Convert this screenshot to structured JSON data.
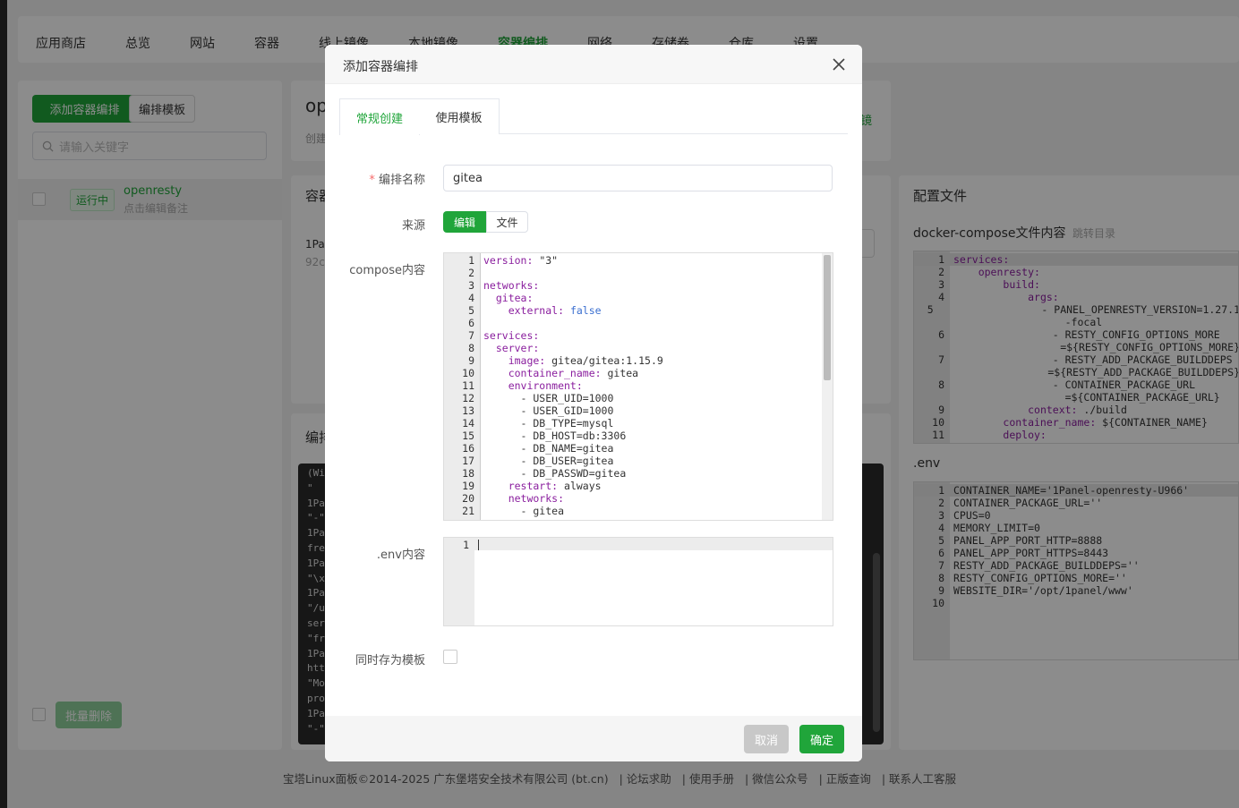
{
  "topnav": [
    "应用商店",
    "总览",
    "网站",
    "容器",
    "线上镜像",
    "本地镜像",
    "容器编排",
    "网络",
    "存储卷",
    "仓库",
    "设置"
  ],
  "topnav_active": 6,
  "left": {
    "add_button": "添加容器编排",
    "template_button": "编排模板",
    "search_placeholder": "请输入关键字",
    "row": {
      "status": "运行中",
      "name": "openresty",
      "note": "点击编辑备注"
    },
    "bulk_delete": "批量删除"
  },
  "mid": {
    "title_fragment": "op",
    "sub_fragment": "创建",
    "section2_fragment": "容器",
    "row_fragment": "1Pa",
    "row_sub_fragment": "92c",
    "section3_fragment": "编排",
    "right_link_fragment": "镜",
    "log_lines": [
      "(Wi",
      "\"",
      "1Pa",
      "\"-\"",
      "1Pa",
      "fre",
      "1Pa",
      "\"\\x",
      "1Pa",
      "\"/u",
      "ser",
      "\"fr",
      "1Pa",
      "htt",
      "\"Mo",
      "pro",
      "1Pa",
      "\"-\""
    ]
  },
  "right": {
    "title": "配置文件",
    "compose_label": "docker-compose文件内容",
    "jump_link": "跳转目录",
    "compose_lines": [
      {
        "n": "1",
        "t": "services:"
      },
      {
        "n": "2",
        "t": "    openresty:"
      },
      {
        "n": "3",
        "t": "        build:"
      },
      {
        "n": "4",
        "t": "            args:"
      },
      {
        "n": "5",
        "t": "                - PANEL_OPENRESTY_VERSION=1.27.1"
      },
      {
        "n": "",
        "t": "                  -focal"
      },
      {
        "n": "6",
        "t": "                - RESTY_CONFIG_OPTIONS_MORE"
      },
      {
        "n": "",
        "t": "                  =${RESTY_CONFIG_OPTIONS_MORE}"
      },
      {
        "n": "7",
        "t": "                - RESTY_ADD_PACKAGE_BUILDDEPS"
      },
      {
        "n": "",
        "t": "                  =${RESTY_ADD_PACKAGE_BUILDDEPS}"
      },
      {
        "n": "8",
        "t": "                - CONTAINER_PACKAGE_URL"
      },
      {
        "n": "",
        "t": "                  =${CONTAINER_PACKAGE_URL}"
      },
      {
        "n": "9",
        "t": "            context: ./build"
      },
      {
        "n": "10",
        "t": "        container_name: ${CONTAINER_NAME}"
      },
      {
        "n": "11",
        "t": "        deploy:"
      }
    ],
    "env_label": ".env",
    "env_lines": [
      {
        "n": "1",
        "t": "CONTAINER_NAME='1Panel-openresty-U966'"
      },
      {
        "n": "2",
        "t": "CONTAINER_PACKAGE_URL=''"
      },
      {
        "n": "3",
        "t": "CPUS=0"
      },
      {
        "n": "4",
        "t": "MEMORY_LIMIT=0"
      },
      {
        "n": "5",
        "t": "PANEL_APP_PORT_HTTP=8888"
      },
      {
        "n": "6",
        "t": "PANEL_APP_PORT_HTTPS=8443"
      },
      {
        "n": "7",
        "t": "RESTY_ADD_PACKAGE_BUILDDEPS=''"
      },
      {
        "n": "8",
        "t": "RESTY_CONFIG_OPTIONS_MORE=''"
      },
      {
        "n": "9",
        "t": "WEBSITE_DIR='/opt/1panel/www'"
      },
      {
        "n": "10",
        "t": ""
      }
    ]
  },
  "modal": {
    "title": "添加容器编排",
    "tab_normal": "常规创建",
    "tab_template": "使用模板",
    "name_label": "编排名称",
    "name_value": "gitea",
    "source_label": "来源",
    "source_edit": "编辑",
    "source_file": "文件",
    "compose_label": "compose内容",
    "compose_lines": [
      {
        "n": "1",
        "k": "version:",
        "v": " \"3\""
      },
      {
        "n": "2",
        "k": "",
        "v": ""
      },
      {
        "n": "3",
        "k": "networks:",
        "v": ""
      },
      {
        "n": "4",
        "k": "  gitea:",
        "v": ""
      },
      {
        "n": "5",
        "k": "    external:",
        "v": " false"
      },
      {
        "n": "6",
        "k": "",
        "v": ""
      },
      {
        "n": "7",
        "k": "services:",
        "v": ""
      },
      {
        "n": "8",
        "k": "  server:",
        "v": ""
      },
      {
        "n": "9",
        "k": "    image:",
        "v": " gitea/gitea:1.15.9"
      },
      {
        "n": "10",
        "k": "    container_name:",
        "v": " gitea"
      },
      {
        "n": "11",
        "k": "    environment:",
        "v": ""
      },
      {
        "n": "12",
        "k": "",
        "v": "      - USER_UID=1000"
      },
      {
        "n": "13",
        "k": "",
        "v": "      - USER_GID=1000"
      },
      {
        "n": "14",
        "k": "",
        "v": "      - DB_TYPE=mysql"
      },
      {
        "n": "15",
        "k": "",
        "v": "      - DB_HOST=db:3306"
      },
      {
        "n": "16",
        "k": "",
        "v": "      - DB_NAME=gitea"
      },
      {
        "n": "17",
        "k": "",
        "v": "      - DB_USER=gitea"
      },
      {
        "n": "18",
        "k": "",
        "v": "      - DB_PASSWD=gitea"
      },
      {
        "n": "19",
        "k": "    restart:",
        "v": " always"
      },
      {
        "n": "20",
        "k": "    networks:",
        "v": ""
      },
      {
        "n": "21",
        "k": "",
        "v": "      - gitea"
      }
    ],
    "env_label": ".env内容",
    "env_line_no": "1",
    "save_template_label": "同时存为模板",
    "cancel": "取消",
    "confirm": "确定"
  },
  "footer": [
    "宝塔Linux面板©2014-2025 广东堡塔安全技术有限公司 (bt.cn)",
    "论坛求助",
    "使用手册",
    "微信公众号",
    "正版查询",
    "联系人工客服"
  ]
}
